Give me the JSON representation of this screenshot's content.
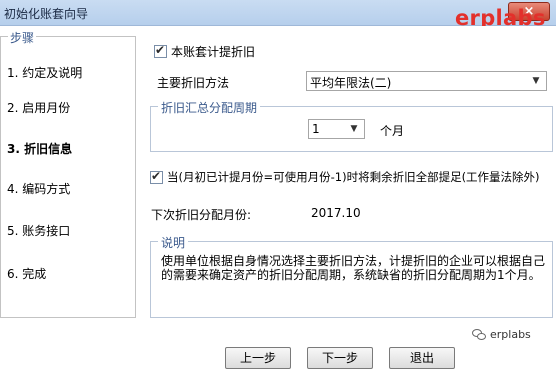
{
  "window": {
    "title": "初始化账套向导",
    "close_label": "×"
  },
  "watermark": {
    "top": "erplabs",
    "bottom": "erplabs"
  },
  "steps": {
    "legend": "步骤",
    "items": [
      {
        "label": "1. 约定及说明"
      },
      {
        "label": "2. 启用月份"
      },
      {
        "label": "3. 折旧信息"
      },
      {
        "label": "4. 编码方式"
      },
      {
        "label": "5. 账务接口"
      },
      {
        "label": "6. 完成"
      }
    ],
    "active_index": 2
  },
  "form": {
    "enable_depreciation": {
      "label": "本账套计提折旧",
      "checked": true
    },
    "method": {
      "label": "主要折旧方法",
      "value": "平均年限法(二)"
    },
    "period_group": {
      "legend": "折旧汇总分配周期",
      "value": "1",
      "unit": "个月"
    },
    "last_month": {
      "label": "当(月初已计提月份=可使用月份-1)时将剩余折旧全部提足(工作量法除外)",
      "checked": true
    },
    "next_month": {
      "label": "下次折旧分配月份:",
      "value": "2017.10"
    },
    "description": {
      "legend": "说明",
      "text": "使用单位根据自身情况选择主要折旧方法，计提折旧的企业可以根据自己的需要来确定资产的折旧分配周期，系统缺省的折旧分配周期为1个月。"
    }
  },
  "buttons": {
    "prev": "上一步",
    "next": "下一步",
    "exit": "退出"
  }
}
